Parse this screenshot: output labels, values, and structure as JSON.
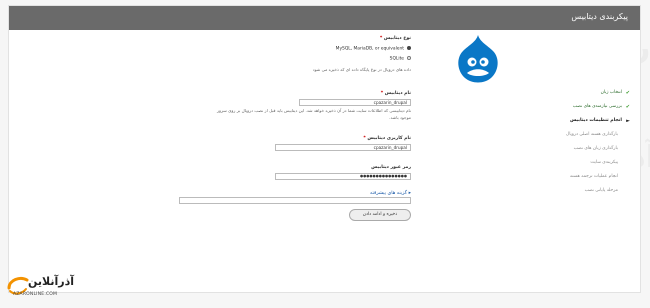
{
  "header": {
    "title": "پیکربندی دیتابیس"
  },
  "steps": [
    {
      "label": "انتخاب زبان",
      "state": "done"
    },
    {
      "label": "بررسی نیازمندی های نصب",
      "state": "done"
    },
    {
      "label": "انجام تنظیمات دیتابیس",
      "state": "active"
    },
    {
      "label": "بارگذاری هسته اصلی دروپال",
      "state": "pending"
    },
    {
      "label": "بارگذاری زبان های نصب",
      "state": "pending"
    },
    {
      "label": "پیکربندی سایت",
      "state": "pending"
    },
    {
      "label": "انجام عملیات ترجمه هسته",
      "state": "pending"
    },
    {
      "label": "مرحله پایانی نصب",
      "state": "pending"
    }
  ],
  "form": {
    "db_type": {
      "label": "نوع دیتابیس",
      "required_mark": "*",
      "options": [
        "MySQL, MariaDB, or equivalent",
        "SQLite"
      ],
      "selected": "MySQL, MariaDB, or equivalent",
      "description": "داده های دروپال در نوع پایگاه داده ای که ذخیره می شود"
    },
    "db_name": {
      "label": "نام دیتابیس",
      "required_mark": "*",
      "value": "cpazarin_drupal",
      "description_line1": "نام دیتابیسی که اطلاعات سایت شما در آن ذخیره خواهد شد. این دیتابیس باید قبل از نصب دروپال بر روی سرور",
      "description_line2": "موجود باشد."
    },
    "db_user": {
      "label": "نام کاربری دیتابیس",
      "required_mark": "*",
      "value": "cpazarin_drupal"
    },
    "db_pass": {
      "label": "رمز عبور دیتابیس",
      "value": "●●●●●●●●●●●●●●●"
    },
    "advanced_label": "گزینه های پیشرفته",
    "advanced_marker": "▸",
    "submit_label": "ذخیره و ادامه دادن"
  },
  "brand": {
    "name": "آذرآنلاین",
    "url": "AZARONLINE.COM"
  },
  "watermark_text": "آذر آنلاین",
  "colors": {
    "header_bg": "#6a6a6a",
    "drupal_blue": "#0a77c6",
    "done_green": "#3a9a2a",
    "link_blue": "#1a5aa8",
    "brand_orange": "#f39200"
  }
}
